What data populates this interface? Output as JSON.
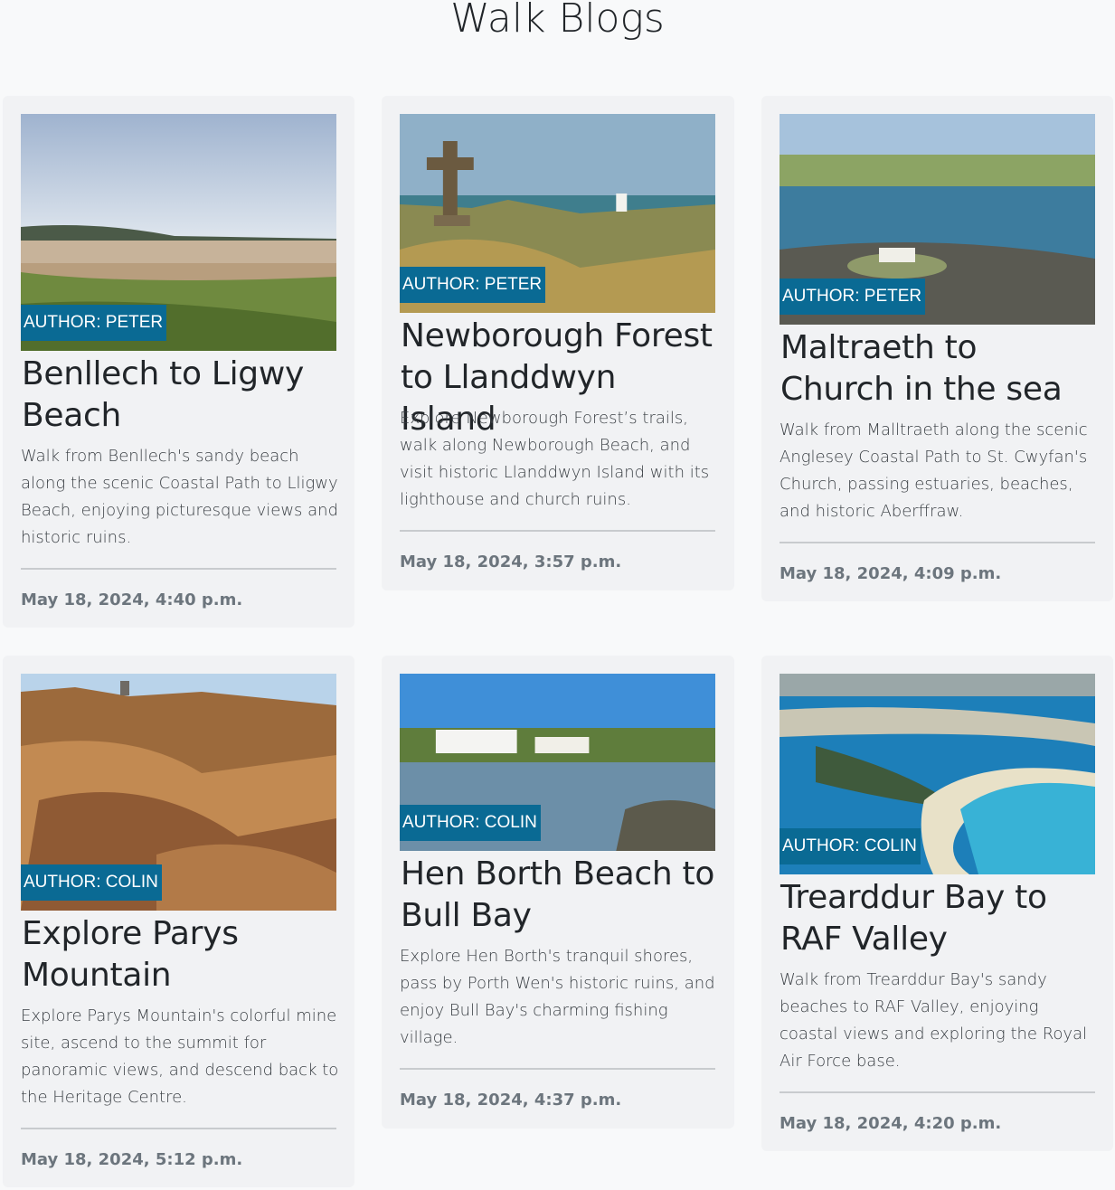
{
  "page": {
    "title": "Walk Blogs"
  },
  "posts": [
    {
      "author": "AUTHOR: PETER",
      "title": "Benllech to Ligwy Beach",
      "excerpt": "Walk from Benllech's sandy beach along the scenic Coastal Path to Lligwy Beach, enjoying picturesque views and historic ruins.",
      "date": "May 18, 2024, 4:40 p.m."
    },
    {
      "author": "AUTHOR: PETER",
      "title": "Newborough Forest to Llanddwyn Island",
      "excerpt": "Explore Newborough Forest’s trails, walk along Newborough Beach, and visit historic Llanddwyn Island with its lighthouse and church ruins.",
      "date": "May 18, 2024, 3:57 p.m."
    },
    {
      "author": "AUTHOR: PETER",
      "title": "Maltraeth to Church in the sea",
      "excerpt": "Walk from Malltraeth along the scenic Anglesey Coastal Path to St. Cwyfan's Church, passing estuaries, beaches, and historic Aberffraw.",
      "date": "May 18, 2024, 4:09 p.m."
    },
    {
      "author": "AUTHOR: COLIN",
      "title": "Explore Parys Mountain",
      "excerpt": "Explore Parys Mountain's colorful mine site, ascend to the summit for panoramic views, and descend back to the Heritage Centre.",
      "date": "May 18, 2024, 5:12 p.m."
    },
    {
      "author": "AUTHOR: COLIN",
      "title": "Hen Borth Beach to Bull Bay",
      "excerpt": "Explore Hen Borth's tranquil shores, pass by Porth Wen's historic ruins, and enjoy Bull Bay's charming fishing village.",
      "date": "May 18, 2024, 4:37 p.m."
    },
    {
      "author": "AUTHOR: COLIN",
      "title": "Trearddur Bay to RAF Valley",
      "excerpt": "Walk from Trearddur Bay's sandy beaches to RAF Valley, enjoying coastal views and exploring the Royal Air Force base.",
      "date": "May 18, 2024, 4:20 p.m."
    }
  ],
  "colors": {
    "author_badge": "#0a6a94",
    "card_bg": "#f1f2f4",
    "page_bg": "#f8f9fa"
  }
}
